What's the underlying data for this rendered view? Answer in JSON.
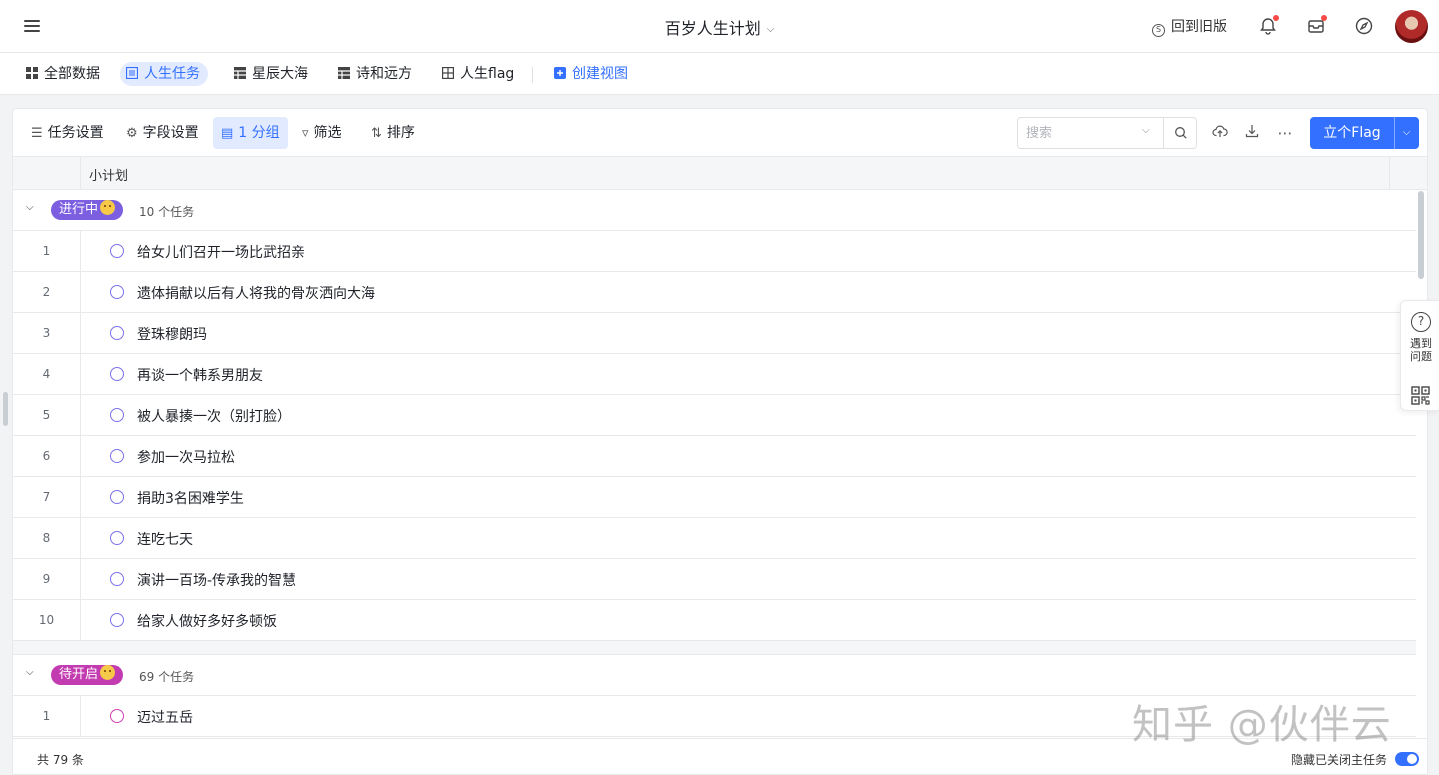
{
  "header": {
    "title": "百岁人生计划",
    "back_old": "回到旧版"
  },
  "views": [
    {
      "label": "全部数据"
    },
    {
      "label": "人生任务"
    },
    {
      "label": "星辰大海"
    },
    {
      "label": "诗和远方"
    },
    {
      "label": "人生flag"
    }
  ],
  "create_view": "创建视图",
  "toolbar": {
    "task_settings": "任务设置",
    "field_settings": "字段设置",
    "group": "1 分组",
    "filter": "筛选",
    "sort": "排序",
    "search_placeholder": "搜索",
    "primary_button": "立个Flag"
  },
  "columns": {
    "name": "小计划"
  },
  "groups": [
    {
      "tag": "进行中",
      "tag_color": "#7b5fe0",
      "count_text": "10 个任务",
      "tasks": [
        {
          "index": "1",
          "text": "给女儿们召开一场比武招亲"
        },
        {
          "index": "2",
          "text": "遗体捐献以后有人将我的骨灰洒向大海"
        },
        {
          "index": "3",
          "text": "登珠穆朗玛"
        },
        {
          "index": "4",
          "text": "再谈一个韩系男朋友"
        },
        {
          "index": "5",
          "text": "被人暴揍一次（别打脸）"
        },
        {
          "index": "6",
          "text": "参加一次马拉松"
        },
        {
          "index": "7",
          "text": "捐助3名困难学生"
        },
        {
          "index": "8",
          "text": "连吃七天"
        },
        {
          "index": "9",
          "text": "演讲一百场-传承我的智慧"
        },
        {
          "index": "10",
          "text": "给家人做好多好多顿饭"
        }
      ]
    },
    {
      "tag": "待开启",
      "tag_color": "#c33bb0",
      "count_text": "69 个任务",
      "tasks": [
        {
          "index": "1",
          "text": "迈过五岳"
        }
      ]
    }
  ],
  "footer": {
    "total": "共 79 条",
    "hide_closed": "隐藏已关闭主任务"
  },
  "helper": {
    "label": "遇到问题"
  },
  "watermark": "知乎 @伙伴云",
  "colors": {
    "accent": "#3370ff",
    "checkbox_group1": "#7b72e9",
    "checkbox_group2": "#d13fb0"
  }
}
